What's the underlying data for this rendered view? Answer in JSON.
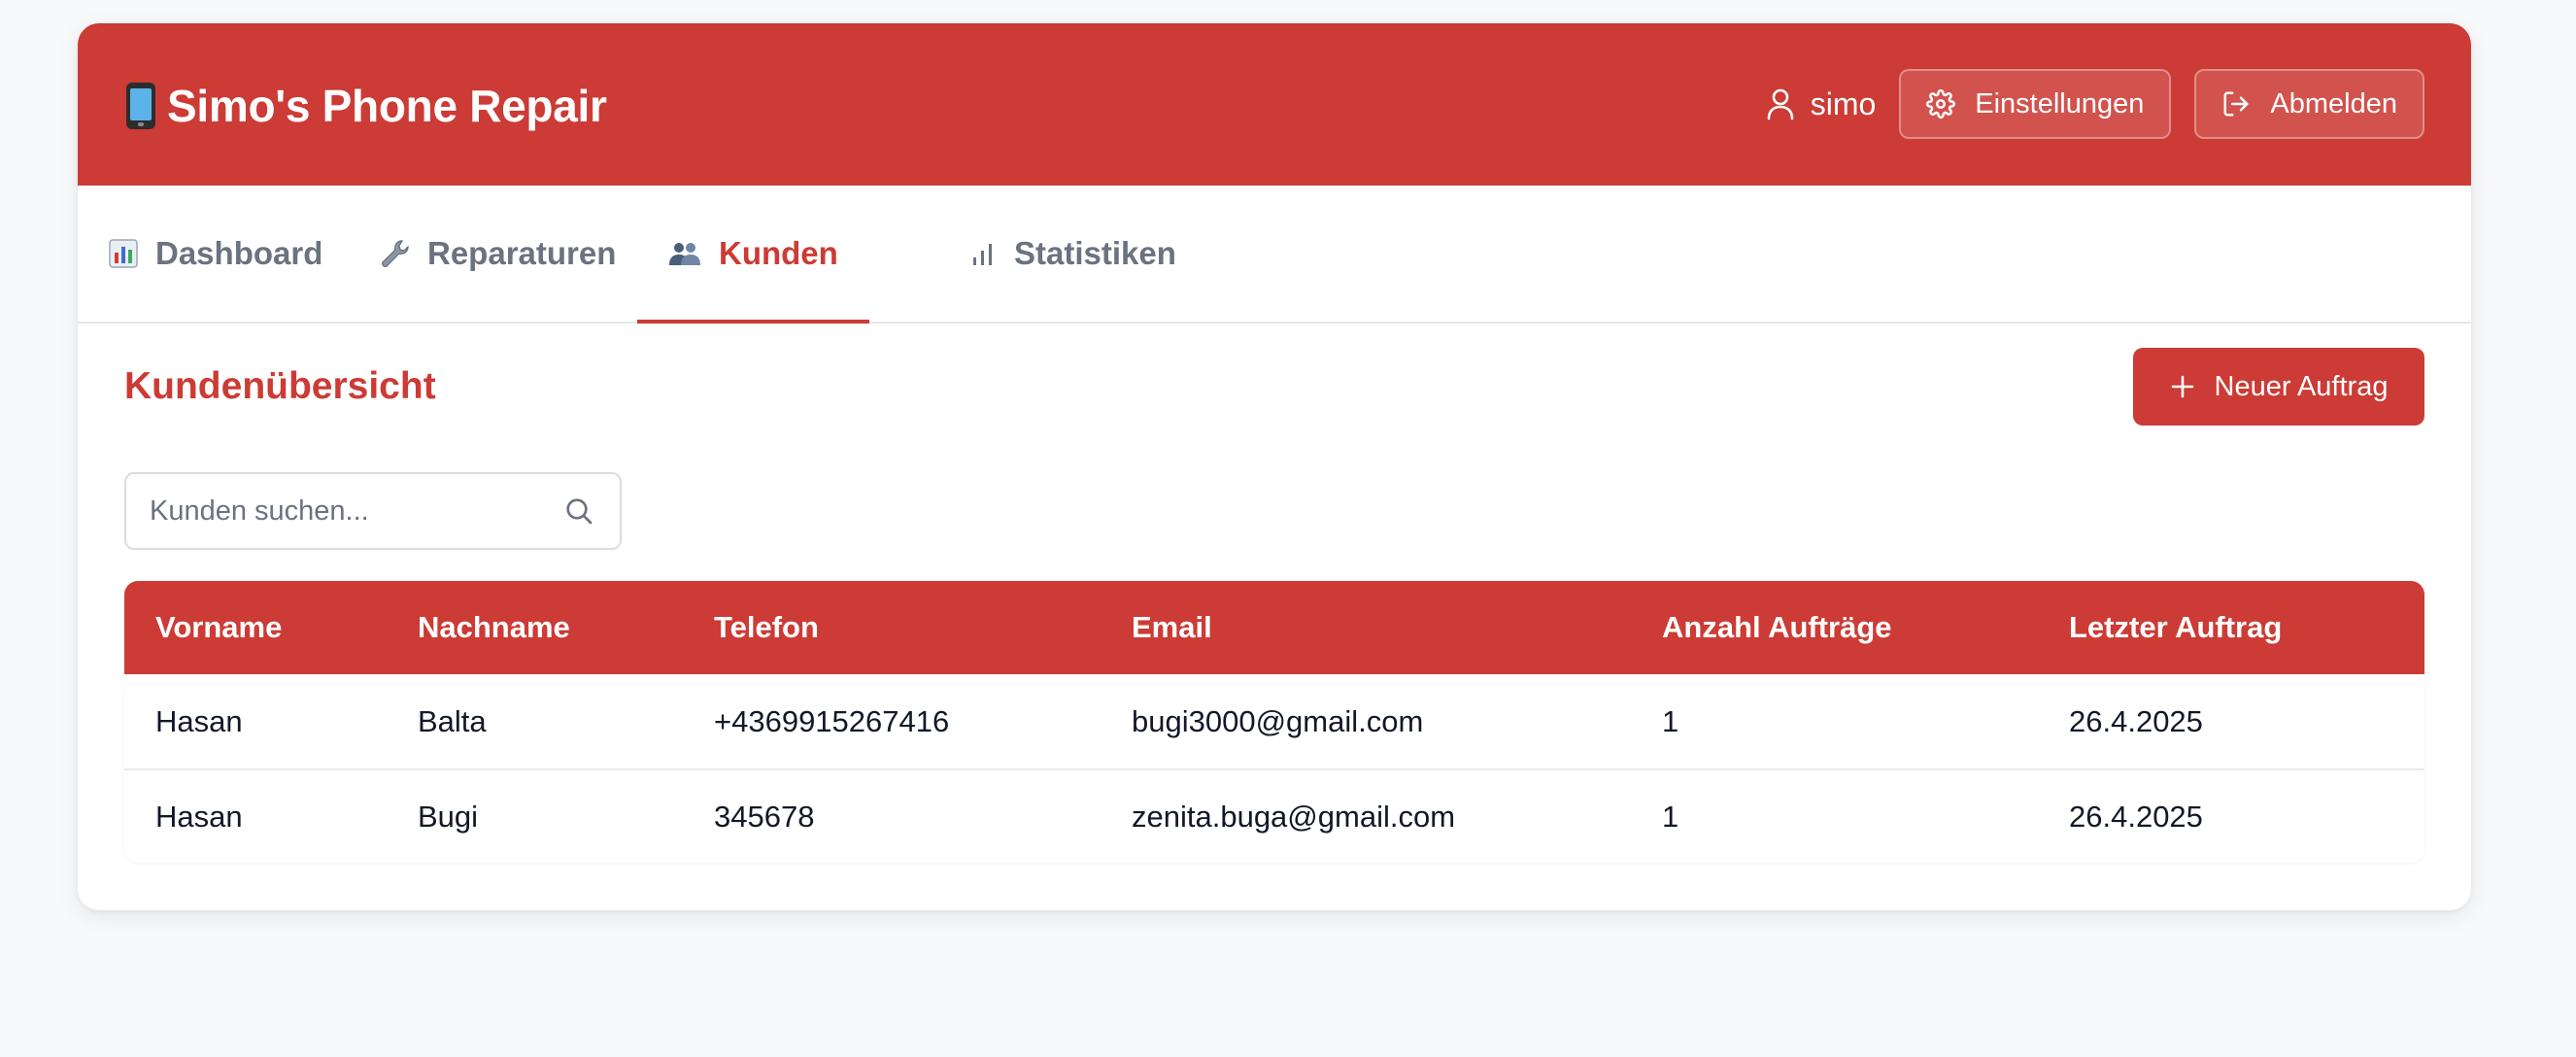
{
  "app": {
    "title": "Simo's Phone Repair",
    "brand_color": "#cc3b35"
  },
  "header": {
    "username": "simo",
    "settings_label": "Einstellungen",
    "logout_label": "Abmelden"
  },
  "tabs": [
    {
      "label": "Dashboard",
      "icon": "bar-chart-icon",
      "active": false
    },
    {
      "label": "Reparaturen",
      "icon": "wrench-icon",
      "active": false
    },
    {
      "label": "Kunden",
      "icon": "users-icon",
      "active": true
    },
    {
      "label": "Statistiken",
      "icon": "signal-bars-icon",
      "active": false
    }
  ],
  "main": {
    "title": "Kundenübersicht",
    "new_order_label": "Neuer Auftrag",
    "search_placeholder": "Kunden suchen..."
  },
  "table": {
    "headers": [
      "Vorname",
      "Nachname",
      "Telefon",
      "Email",
      "Anzahl Aufträge",
      "Letzter Auftrag"
    ],
    "rows": [
      [
        "Hasan",
        "Balta",
        "+4369915267416",
        "bugi3000@gmail.com",
        "1",
        "26.4.2025"
      ],
      [
        "Hasan",
        "Bugi",
        "345678",
        "zenita.buga@gmail.com",
        "1",
        "26.4.2025"
      ]
    ]
  }
}
